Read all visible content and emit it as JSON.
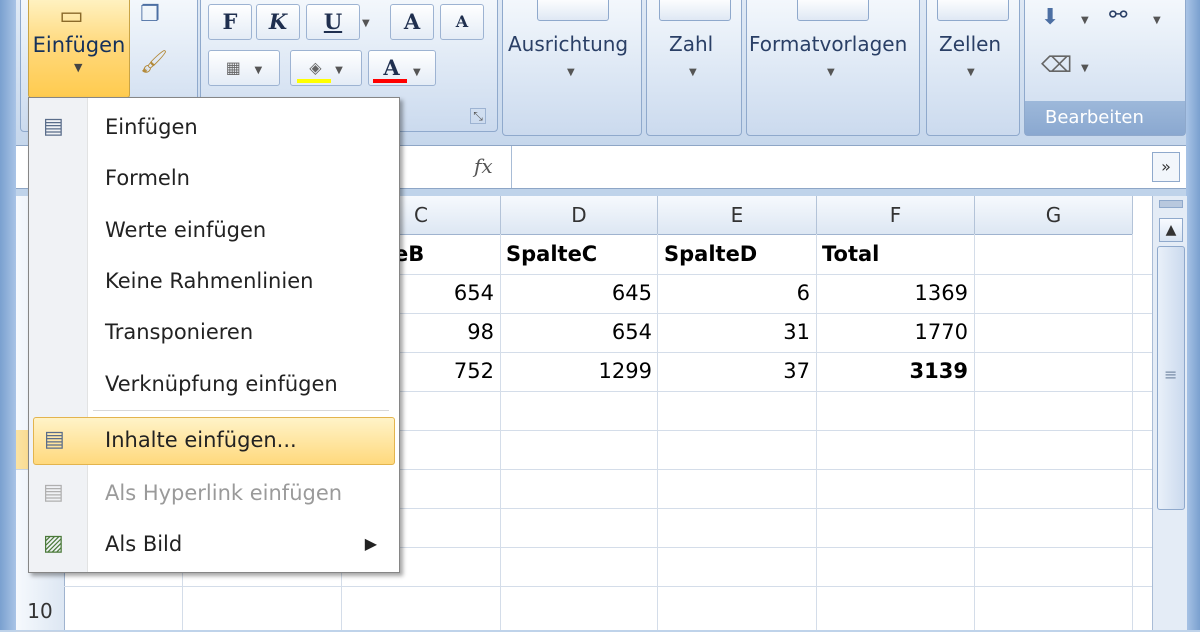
{
  "ribbon": {
    "paste_label": "Einfügen",
    "bold": "F",
    "italic": "K",
    "underline": "U",
    "font_grow": "A",
    "font_shrink": "A",
    "font_color": "A",
    "groups": {
      "alignment": "Ausrichtung",
      "number": "Zahl",
      "styles": "Formatvorlagen",
      "cells": "Zellen",
      "editing": "Bearbeiten"
    }
  },
  "formula_bar": {
    "fx_label": "fx"
  },
  "grid": {
    "columns": [
      "C",
      "D",
      "E",
      "F",
      "G"
    ],
    "rows": [
      "10"
    ],
    "header_row": [
      "teB",
      "SpalteC",
      "SpalteD",
      "Total"
    ],
    "data": [
      [
        "654",
        "645",
        "6",
        "1369"
      ],
      [
        "98",
        "654",
        "31",
        "1770"
      ],
      [
        "752",
        "1299",
        "37",
        "3139"
      ]
    ]
  },
  "context_menu": {
    "items": [
      {
        "label": "Einfügen"
      },
      {
        "label": "Formeln"
      },
      {
        "label": "Werte einfügen"
      },
      {
        "label": "Keine Rahmenlinien"
      },
      {
        "label": "Transponieren"
      },
      {
        "label": "Verknüpfung einfügen"
      },
      {
        "label": "Inhalte einfügen..."
      },
      {
        "label": "Als Hyperlink einfügen"
      },
      {
        "label": "Als Bild"
      }
    ]
  },
  "colors": {
    "highlight": "#ffd97d",
    "fill_bar": "#ffff00",
    "font_bar": "#ff0000"
  }
}
